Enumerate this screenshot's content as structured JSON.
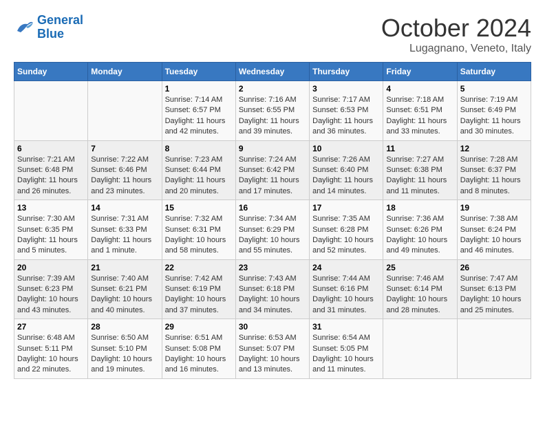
{
  "header": {
    "logo_line1": "General",
    "logo_line2": "Blue",
    "month": "October 2024",
    "location": "Lugagnano, Veneto, Italy"
  },
  "weekdays": [
    "Sunday",
    "Monday",
    "Tuesday",
    "Wednesday",
    "Thursday",
    "Friday",
    "Saturday"
  ],
  "weeks": [
    [
      {
        "day": "",
        "info": ""
      },
      {
        "day": "",
        "info": ""
      },
      {
        "day": "1",
        "info": "Sunrise: 7:14 AM\nSunset: 6:57 PM\nDaylight: 11 hours and 42 minutes."
      },
      {
        "day": "2",
        "info": "Sunrise: 7:16 AM\nSunset: 6:55 PM\nDaylight: 11 hours and 39 minutes."
      },
      {
        "day": "3",
        "info": "Sunrise: 7:17 AM\nSunset: 6:53 PM\nDaylight: 11 hours and 36 minutes."
      },
      {
        "day": "4",
        "info": "Sunrise: 7:18 AM\nSunset: 6:51 PM\nDaylight: 11 hours and 33 minutes."
      },
      {
        "day": "5",
        "info": "Sunrise: 7:19 AM\nSunset: 6:49 PM\nDaylight: 11 hours and 30 minutes."
      }
    ],
    [
      {
        "day": "6",
        "info": "Sunrise: 7:21 AM\nSunset: 6:48 PM\nDaylight: 11 hours and 26 minutes."
      },
      {
        "day": "7",
        "info": "Sunrise: 7:22 AM\nSunset: 6:46 PM\nDaylight: 11 hours and 23 minutes."
      },
      {
        "day": "8",
        "info": "Sunrise: 7:23 AM\nSunset: 6:44 PM\nDaylight: 11 hours and 20 minutes."
      },
      {
        "day": "9",
        "info": "Sunrise: 7:24 AM\nSunset: 6:42 PM\nDaylight: 11 hours and 17 minutes."
      },
      {
        "day": "10",
        "info": "Sunrise: 7:26 AM\nSunset: 6:40 PM\nDaylight: 11 hours and 14 minutes."
      },
      {
        "day": "11",
        "info": "Sunrise: 7:27 AM\nSunset: 6:38 PM\nDaylight: 11 hours and 11 minutes."
      },
      {
        "day": "12",
        "info": "Sunrise: 7:28 AM\nSunset: 6:37 PM\nDaylight: 11 hours and 8 minutes."
      }
    ],
    [
      {
        "day": "13",
        "info": "Sunrise: 7:30 AM\nSunset: 6:35 PM\nDaylight: 11 hours and 5 minutes."
      },
      {
        "day": "14",
        "info": "Sunrise: 7:31 AM\nSunset: 6:33 PM\nDaylight: 11 hours and 1 minute."
      },
      {
        "day": "15",
        "info": "Sunrise: 7:32 AM\nSunset: 6:31 PM\nDaylight: 10 hours and 58 minutes."
      },
      {
        "day": "16",
        "info": "Sunrise: 7:34 AM\nSunset: 6:29 PM\nDaylight: 10 hours and 55 minutes."
      },
      {
        "day": "17",
        "info": "Sunrise: 7:35 AM\nSunset: 6:28 PM\nDaylight: 10 hours and 52 minutes."
      },
      {
        "day": "18",
        "info": "Sunrise: 7:36 AM\nSunset: 6:26 PM\nDaylight: 10 hours and 49 minutes."
      },
      {
        "day": "19",
        "info": "Sunrise: 7:38 AM\nSunset: 6:24 PM\nDaylight: 10 hours and 46 minutes."
      }
    ],
    [
      {
        "day": "20",
        "info": "Sunrise: 7:39 AM\nSunset: 6:23 PM\nDaylight: 10 hours and 43 minutes."
      },
      {
        "day": "21",
        "info": "Sunrise: 7:40 AM\nSunset: 6:21 PM\nDaylight: 10 hours and 40 minutes."
      },
      {
        "day": "22",
        "info": "Sunrise: 7:42 AM\nSunset: 6:19 PM\nDaylight: 10 hours and 37 minutes."
      },
      {
        "day": "23",
        "info": "Sunrise: 7:43 AM\nSunset: 6:18 PM\nDaylight: 10 hours and 34 minutes."
      },
      {
        "day": "24",
        "info": "Sunrise: 7:44 AM\nSunset: 6:16 PM\nDaylight: 10 hours and 31 minutes."
      },
      {
        "day": "25",
        "info": "Sunrise: 7:46 AM\nSunset: 6:14 PM\nDaylight: 10 hours and 28 minutes."
      },
      {
        "day": "26",
        "info": "Sunrise: 7:47 AM\nSunset: 6:13 PM\nDaylight: 10 hours and 25 minutes."
      }
    ],
    [
      {
        "day": "27",
        "info": "Sunrise: 6:48 AM\nSunset: 5:11 PM\nDaylight: 10 hours and 22 minutes."
      },
      {
        "day": "28",
        "info": "Sunrise: 6:50 AM\nSunset: 5:10 PM\nDaylight: 10 hours and 19 minutes."
      },
      {
        "day": "29",
        "info": "Sunrise: 6:51 AM\nSunset: 5:08 PM\nDaylight: 10 hours and 16 minutes."
      },
      {
        "day": "30",
        "info": "Sunrise: 6:53 AM\nSunset: 5:07 PM\nDaylight: 10 hours and 13 minutes."
      },
      {
        "day": "31",
        "info": "Sunrise: 6:54 AM\nSunset: 5:05 PM\nDaylight: 10 hours and 11 minutes."
      },
      {
        "day": "",
        "info": ""
      },
      {
        "day": "",
        "info": ""
      }
    ]
  ]
}
